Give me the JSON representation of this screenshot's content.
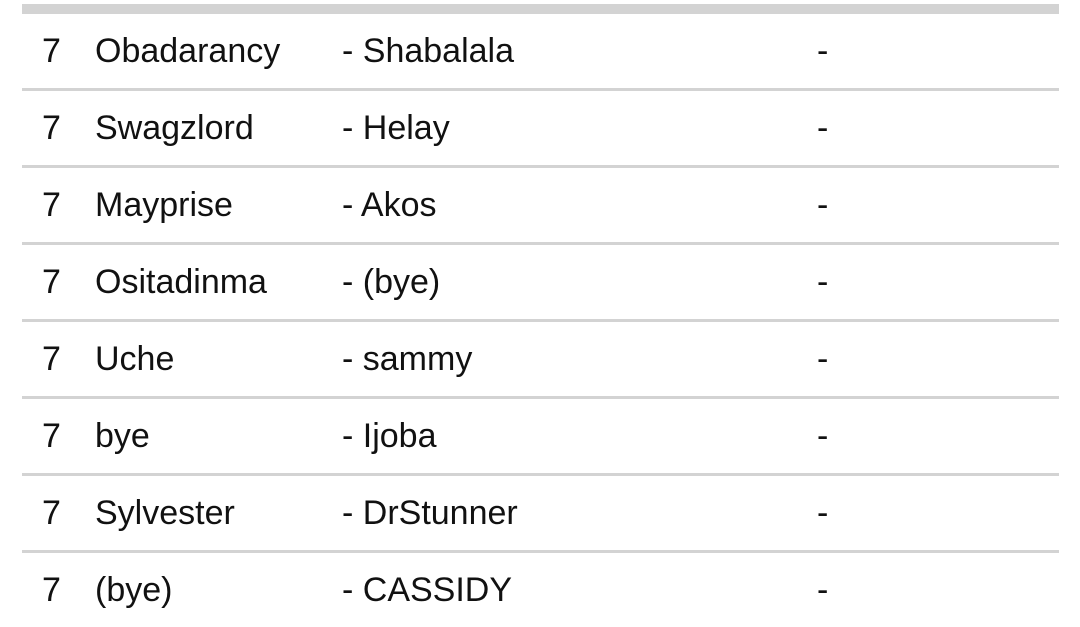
{
  "fixtures": {
    "rows": [
      {
        "round": "7",
        "home": "Obadarancy",
        "away": "- Shabalala",
        "score": "-"
      },
      {
        "round": "7",
        "home": "Swagzlord",
        "away": "- Helay",
        "score": "-"
      },
      {
        "round": "7",
        "home": "Mayprise",
        "away": "- Akos",
        "score": "-"
      },
      {
        "round": "7",
        "home": "Ositadinma",
        "away": "- (bye)",
        "score": "-"
      },
      {
        "round": "7",
        "home": "Uche",
        "away": "- sammy",
        "score": "-"
      },
      {
        "round": "7",
        "home": "bye",
        "away": "- Ijoba",
        "score": "-"
      },
      {
        "round": "7",
        "home": "Sylvester",
        "away": "- DrStunner",
        "score": "-"
      },
      {
        "round": "7",
        "home": "(bye)",
        "away": "- CASSIDY",
        "score": "-"
      }
    ]
  }
}
